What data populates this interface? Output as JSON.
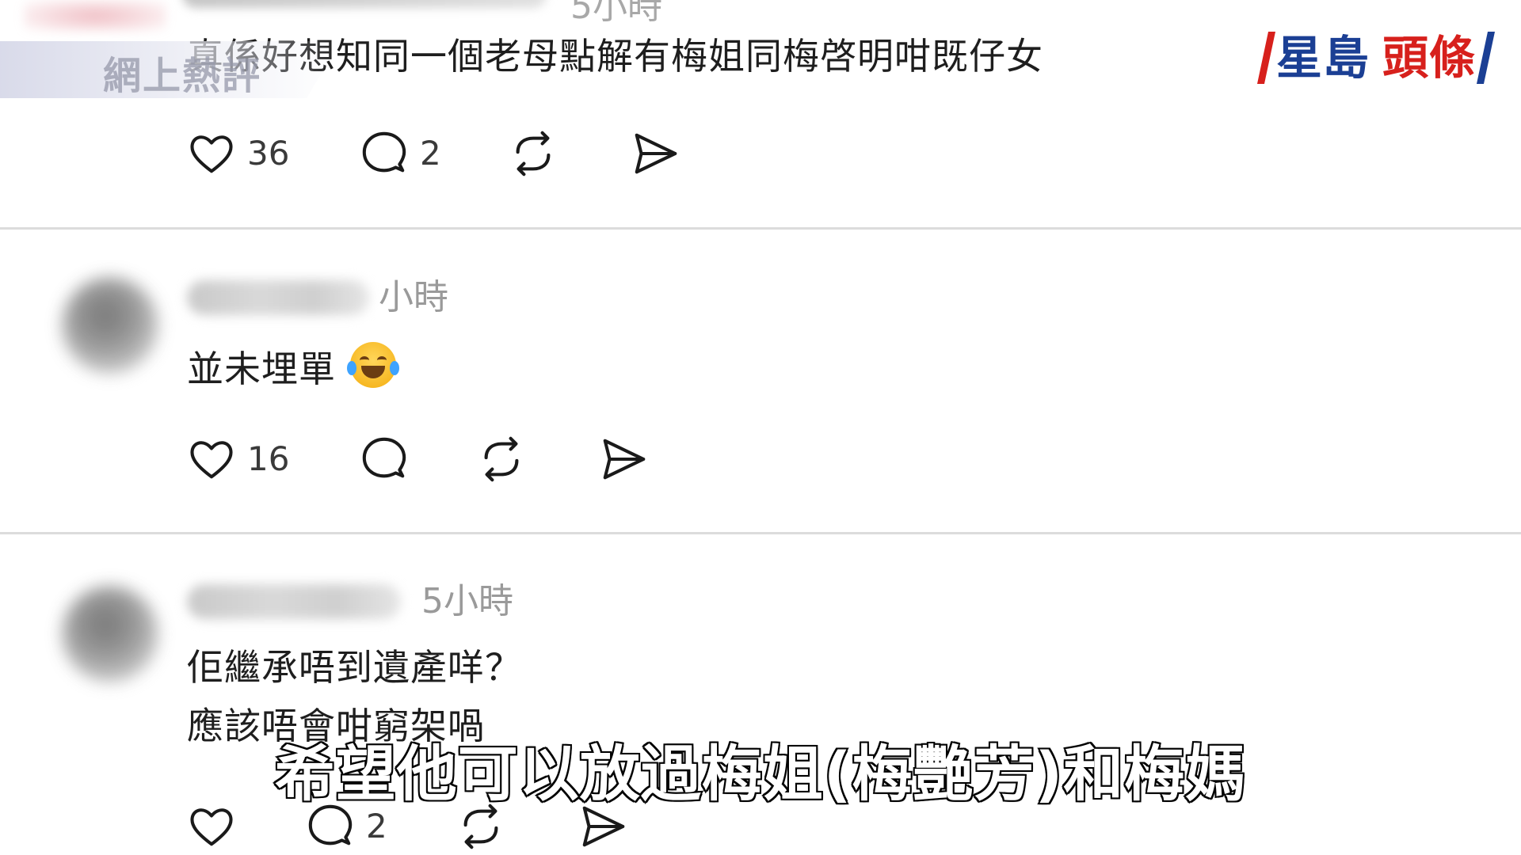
{
  "overlay": {
    "section_label": "網上熱評",
    "top_time_partial": "5小時"
  },
  "brand": {
    "name_part1": "星島",
    "name_part2": "頭條"
  },
  "comments": [
    {
      "time": "",
      "lines": [
        "真係好想知同一個老母點解有梅姐同梅啓明咁既仔女"
      ],
      "emoji": "",
      "likes": "36",
      "replies": "2"
    },
    {
      "time": "小時",
      "lines": [
        "並未埋單"
      ],
      "emoji": "face-with-tears-of-joy",
      "likes": "16",
      "replies": ""
    },
    {
      "time": "5小時",
      "lines": [
        "佢繼承唔到遺產咩？",
        "應該唔會咁窮架喎"
      ],
      "emoji": "",
      "likes": "",
      "replies": "2"
    }
  ],
  "icons": {
    "like": "heart-icon",
    "reply": "comment-bubble-icon",
    "repost": "repost-icon",
    "share": "send-icon"
  },
  "subtitle": "希望他可以放過梅姐(梅艷芳)和梅媽",
  "colors": {
    "brand_blue": "#1b3f94",
    "brand_red": "#d7201c",
    "subtitle_fill": "#ffffff",
    "subtitle_stroke": "#111111"
  }
}
